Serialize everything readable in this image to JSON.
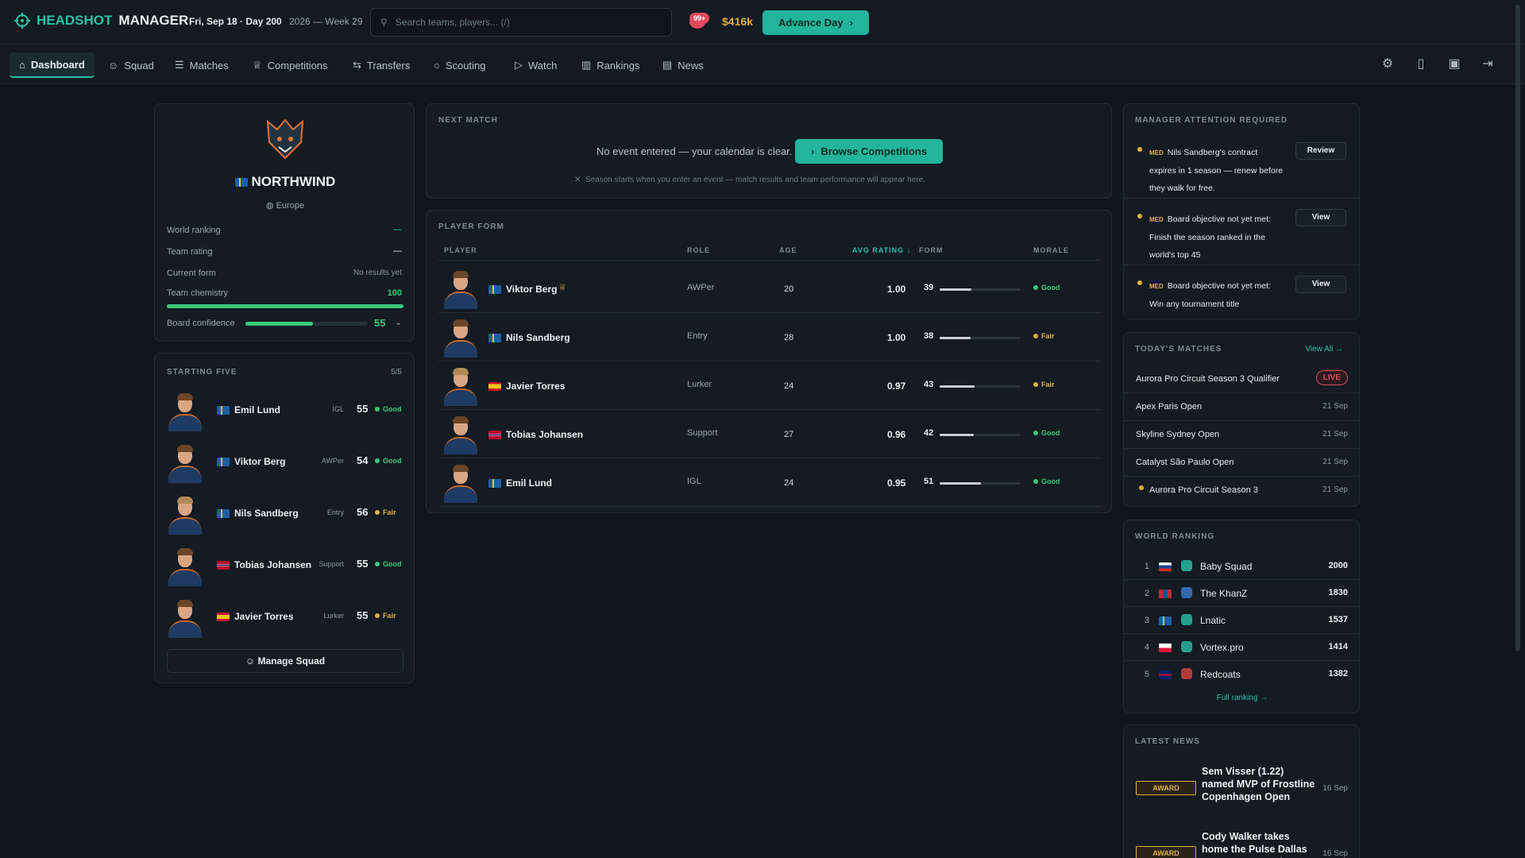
{
  "app": {
    "brand_a": "HEADSHOT",
    "brand_b": "MANAGER",
    "date": "Fri, Sep 18 · Day 200",
    "week": "2026 — Week 29",
    "search_placeholder": "Search teams, players... (/)",
    "notif": "99+",
    "money": "$416k",
    "advance": "Advance Day"
  },
  "nav": {
    "tabs": [
      "Dashboard",
      "Squad",
      "Matches",
      "Competitions",
      "Transfers",
      "Scouting",
      "Watch",
      "Rankings",
      "News"
    ],
    "icons": [
      "settings-icon",
      "book-icon",
      "save-icon",
      "logout-icon"
    ]
  },
  "team": {
    "name": "NORTHWIND",
    "region": "Europe",
    "world_ranking_label": "World ranking",
    "world_ranking": "—",
    "team_rating_label": "Team rating",
    "team_rating": "—",
    "form_label": "Current form",
    "form": "No results yet",
    "chem_label": "Team chemistry",
    "chem": "100",
    "chem_fill": 1.0,
    "board_label": "Board confidence",
    "board": "55",
    "board_fill": 0.55
  },
  "starting": {
    "title": "STARTING FIVE",
    "count": "5/5",
    "players": [
      {
        "name": "Emil Lund",
        "role": "IGL",
        "rating": "55",
        "morale": "Good",
        "flag": "se"
      },
      {
        "name": "Viktor Berg",
        "role": "AWPer",
        "rating": "54",
        "morale": "Good",
        "flag": "se"
      },
      {
        "name": "Nils Sandberg",
        "role": "Entry",
        "rating": "56",
        "morale": "Fair",
        "flag": "se"
      },
      {
        "name": "Tobias Johansen",
        "role": "Support",
        "rating": "55",
        "morale": "Good",
        "flag": "no"
      },
      {
        "name": "Javier Torres",
        "role": "Lurker",
        "rating": "55",
        "morale": "Fair",
        "flag": "es"
      }
    ],
    "manage": "Manage Squad"
  },
  "next": {
    "title": "NEXT MATCH",
    "text": "No event entered — your calendar is clear.",
    "button": "Browse Competitions",
    "note": "Season starts when you enter an event — match results and team performance will appear here."
  },
  "form": {
    "title": "PLAYER FORM",
    "headers": [
      "PLAYER",
      "ROLE",
      "AGE",
      "AVG RATING",
      "FORM",
      "MORALE"
    ],
    "rows": [
      {
        "name": "Viktor Berg",
        "flag": "se",
        "role": "AWPer",
        "age": "20",
        "rating": "1.00",
        "form": "39",
        "form_fill": 0.39,
        "morale": "Good"
      },
      {
        "name": "Nils Sandberg",
        "flag": "se",
        "role": "Entry",
        "age": "28",
        "rating": "1.00",
        "form": "38",
        "form_fill": 0.38,
        "morale": "Fair"
      },
      {
        "name": "Javier Torres",
        "flag": "es",
        "role": "Lurker",
        "age": "24",
        "rating": "0.97",
        "form": "43",
        "form_fill": 0.43,
        "morale": "Fair"
      },
      {
        "name": "Tobias Johansen",
        "flag": "no",
        "role": "Support",
        "age": "27",
        "rating": "0.96",
        "form": "42",
        "form_fill": 0.42,
        "morale": "Good"
      },
      {
        "name": "Emil Lund",
        "flag": "se",
        "role": "IGL",
        "age": "24",
        "rating": "0.95",
        "form": "51",
        "form_fill": 0.51,
        "morale": "Good"
      }
    ]
  },
  "attention": {
    "title": "MANAGER ATTENTION REQUIRED",
    "items": [
      {
        "tag": "MED",
        "text": "Nils Sandberg's contract expires in 1 season — renew before they walk for free.",
        "button": "Review"
      },
      {
        "tag": "MED",
        "text": "Board objective not yet met: Finish the season ranked in the world's top 45",
        "button": "View"
      },
      {
        "tag": "MED",
        "text": "Board objective not yet met: Win any tournament title",
        "button": "View"
      }
    ]
  },
  "today": {
    "title": "TODAY'S MATCHES",
    "view_all": "View All →",
    "items": [
      {
        "name": "Aurora Pro Circuit Season 3 Qualifier",
        "date": "LIVE"
      },
      {
        "name": "Apex Paris Open",
        "date": "21 Sep"
      },
      {
        "name": "Skyline Sydney Open",
        "date": "21 Sep"
      },
      {
        "name": "Catalyst São Paulo Open",
        "date": "21 Sep"
      },
      {
        "name": "Aurora Pro Circuit Season 3",
        "date": "21 Sep"
      }
    ]
  },
  "ranking": {
    "title": "WORLD RANKING",
    "items": [
      {
        "pos": "1",
        "name": "Baby Squad",
        "pts": "2000",
        "flag": "ru"
      },
      {
        "pos": "2",
        "name": "The KhanZ",
        "pts": "1830",
        "flag": "mn"
      },
      {
        "pos": "3",
        "name": "Lnatic",
        "pts": "1537",
        "flag": "se"
      },
      {
        "pos": "4",
        "name": "Vortex.pro",
        "pts": "1414",
        "flag": "pl"
      },
      {
        "pos": "5",
        "name": "Redcoats",
        "pts": "1382",
        "flag": "gb"
      }
    ],
    "full": "Full ranking →"
  },
  "news": {
    "title": "LATEST NEWS",
    "items": [
      {
        "tag": "AWARD",
        "text": "Sem Visser (1.22) named MVP of Frostline Copenhagen Open",
        "date": "16 Sep"
      },
      {
        "tag": "AWARD",
        "text": "Cody Walker takes home the Pulse Dallas Open MVP award",
        "date": "16 Sep"
      }
    ]
  }
}
